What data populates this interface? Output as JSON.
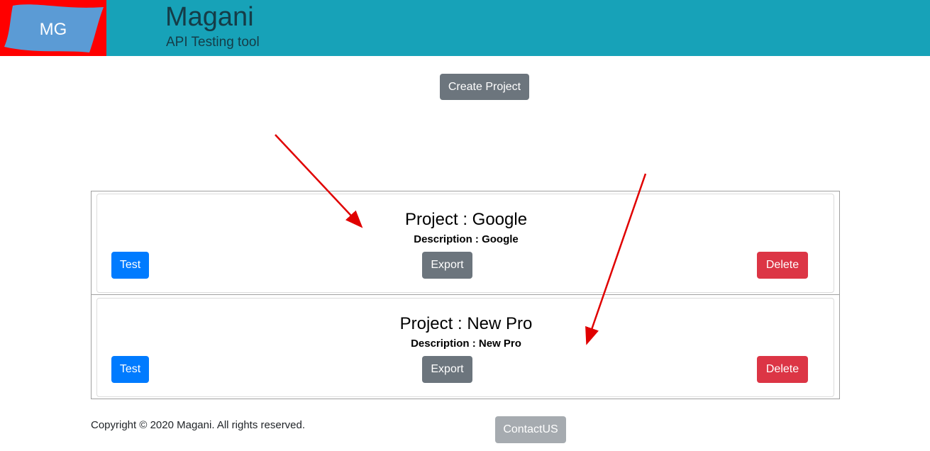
{
  "header": {
    "logo_text": "MG",
    "title": "Magani",
    "subtitle": "API Testing tool"
  },
  "actions": {
    "create_project_label": "Create Project"
  },
  "projects": [
    {
      "title": "Project : Google",
      "description": "Description : Google",
      "test_label": "Test",
      "export_label": "Export",
      "delete_label": "Delete"
    },
    {
      "title": "Project : New Pro",
      "description": "Description : New Pro",
      "test_label": "Test",
      "export_label": "Export",
      "delete_label": "Delete"
    }
  ],
  "footer": {
    "copyright": "Copyright © 2020 Magani. All rights reserved.",
    "contact_label": "ContactUS"
  },
  "colors": {
    "header_bg": "#17a2b8",
    "logo_bg": "#ff0000",
    "logo_flag": "#5b9bd5",
    "primary": "#007bff",
    "secondary": "#6c757d",
    "danger": "#dc3545",
    "annotation_arrow": "#e00000"
  }
}
